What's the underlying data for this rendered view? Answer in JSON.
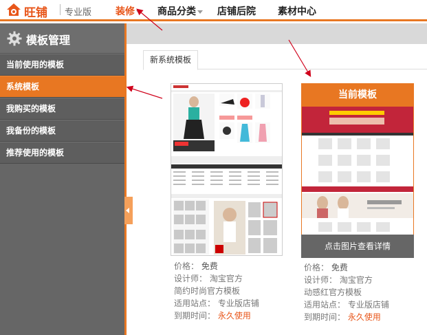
{
  "header": {
    "logo_text": "旺铺",
    "edition": "专业版",
    "nav": [
      {
        "label": "装修",
        "active": true,
        "has_caret": true
      },
      {
        "label": "商品分类",
        "active": false,
        "has_caret": true
      },
      {
        "label": "店铺后院",
        "active": false,
        "has_caret": false
      },
      {
        "label": "素材中心",
        "active": false,
        "has_caret": false
      }
    ]
  },
  "sidebar": {
    "title": "模板管理",
    "items": [
      {
        "label": "当前使用的模板",
        "active": false
      },
      {
        "label": "系统模板",
        "active": true
      },
      {
        "label": "我购买的模板",
        "active": false
      },
      {
        "label": "我备份的模板",
        "active": false
      },
      {
        "label": "推荐使用的模板",
        "active": false
      }
    ]
  },
  "main": {
    "tab_label": "新系统模板",
    "templates": [
      {
        "badge": "",
        "footer": "",
        "price_label": "价格：",
        "price": "免费",
        "designer_label": "设计师：",
        "designer": "淘宝官方",
        "name": "简约时尚官方模板",
        "site_label": "适用站点：",
        "site": "专业版店铺",
        "expire_label": "到期时间：",
        "expire": "永久使用"
      },
      {
        "badge": "当前模板",
        "footer": "点击图片查看详情",
        "price_label": "价格：",
        "price": "免费",
        "designer_label": "设计师：",
        "designer": "淘宝官方",
        "name": "动感红官方模板",
        "site_label": "适用站点：",
        "site": "专业版店铺",
        "expire_label": "到期时间：",
        "expire": "永久使用"
      }
    ]
  },
  "colors": {
    "accent": "#e87722",
    "sidebar_bg": "#5e5e5e",
    "arrow": "#d0021b"
  }
}
